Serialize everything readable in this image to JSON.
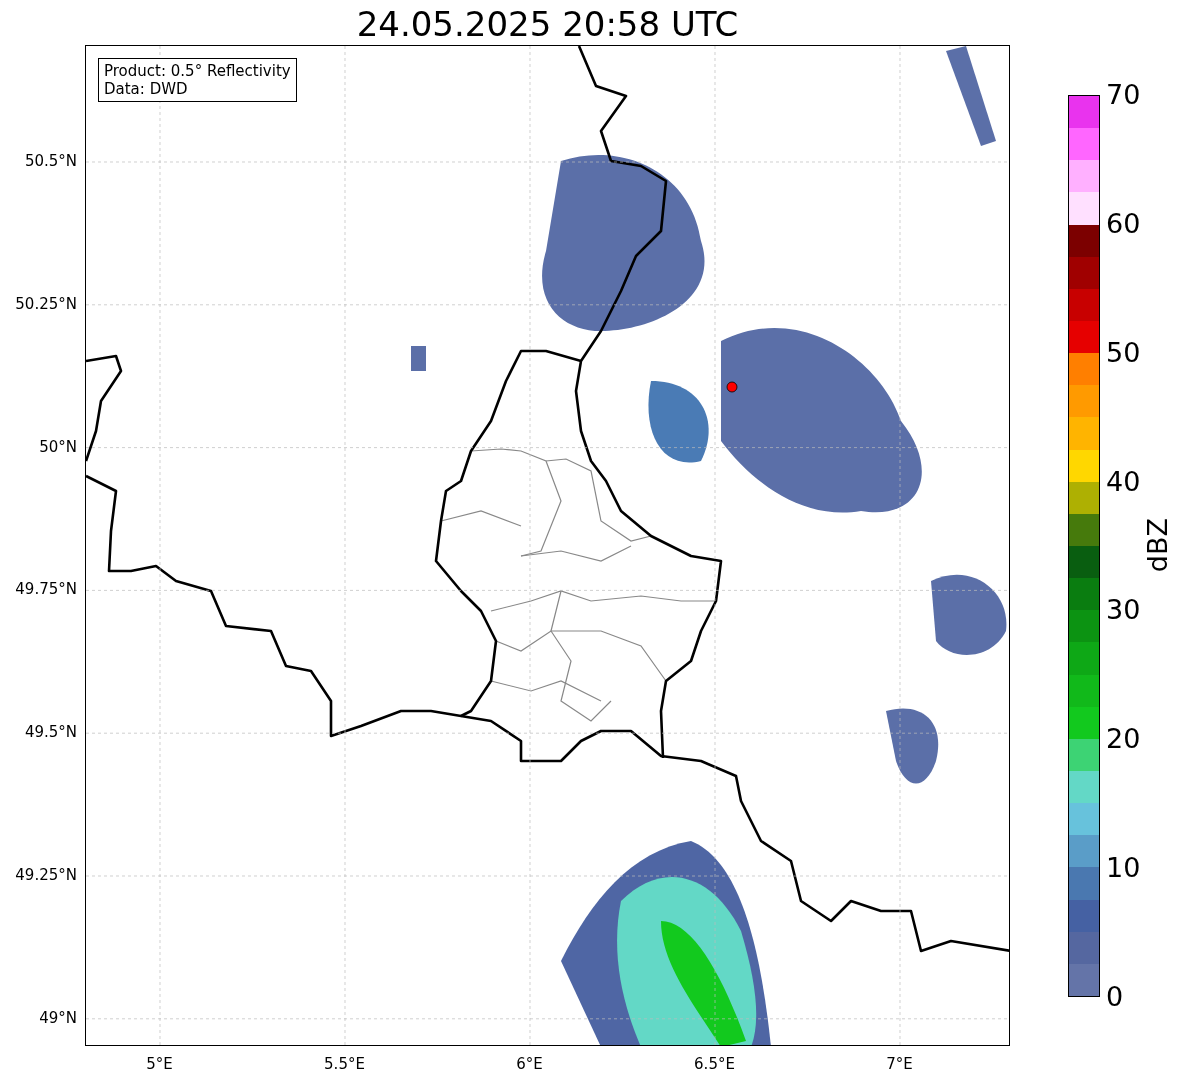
{
  "title": "24.05.2025 20:58 UTC",
  "info_box": {
    "lines": [
      "Product: 0.5° Reflectivity",
      "Data: DWD"
    ]
  },
  "map": {
    "xticks": [
      "5°E",
      "5.5°E",
      "6°E",
      "6.5°E",
      "7°E"
    ],
    "yticks": [
      "50.5°N",
      "50.25°N",
      "50°N",
      "49.75°N",
      "49.5°N",
      "49.25°N",
      "49°N"
    ]
  },
  "colorbar": {
    "label": "dBZ",
    "ticks": [
      "70",
      "60",
      "50",
      "40",
      "30",
      "20",
      "10",
      "0"
    ],
    "levels": [
      {
        "color": "#6474a8"
      },
      {
        "color": "#5567a0"
      },
      {
        "color": "#4561a3"
      },
      {
        "color": "#4a78b0"
      },
      {
        "color": "#5a9dc8"
      },
      {
        "color": "#67c2dc"
      },
      {
        "color": "#63d8c6"
      },
      {
        "color": "#3dd374"
      },
      {
        "color": "#12c91e"
      },
      {
        "color": "#11b91a"
      },
      {
        "color": "#0ea816"
      },
      {
        "color": "#0c9312"
      },
      {
        "color": "#0a7d10"
      },
      {
        "color": "#095e10"
      },
      {
        "color": "#467a0c"
      },
      {
        "color": "#aeb002"
      },
      {
        "color": "#ffd700"
      },
      {
        "color": "#ffb400"
      },
      {
        "color": "#ff9a00"
      },
      {
        "color": "#ff7f00"
      },
      {
        "color": "#e60000"
      },
      {
        "color": "#c80000"
      },
      {
        "color": "#a00000"
      },
      {
        "color": "#7c0000"
      },
      {
        "color": "#ffe0ff"
      },
      {
        "color": "#ffb0ff"
      },
      {
        "color": "#ff66ff"
      },
      {
        "color": "#e933ee"
      }
    ]
  }
}
